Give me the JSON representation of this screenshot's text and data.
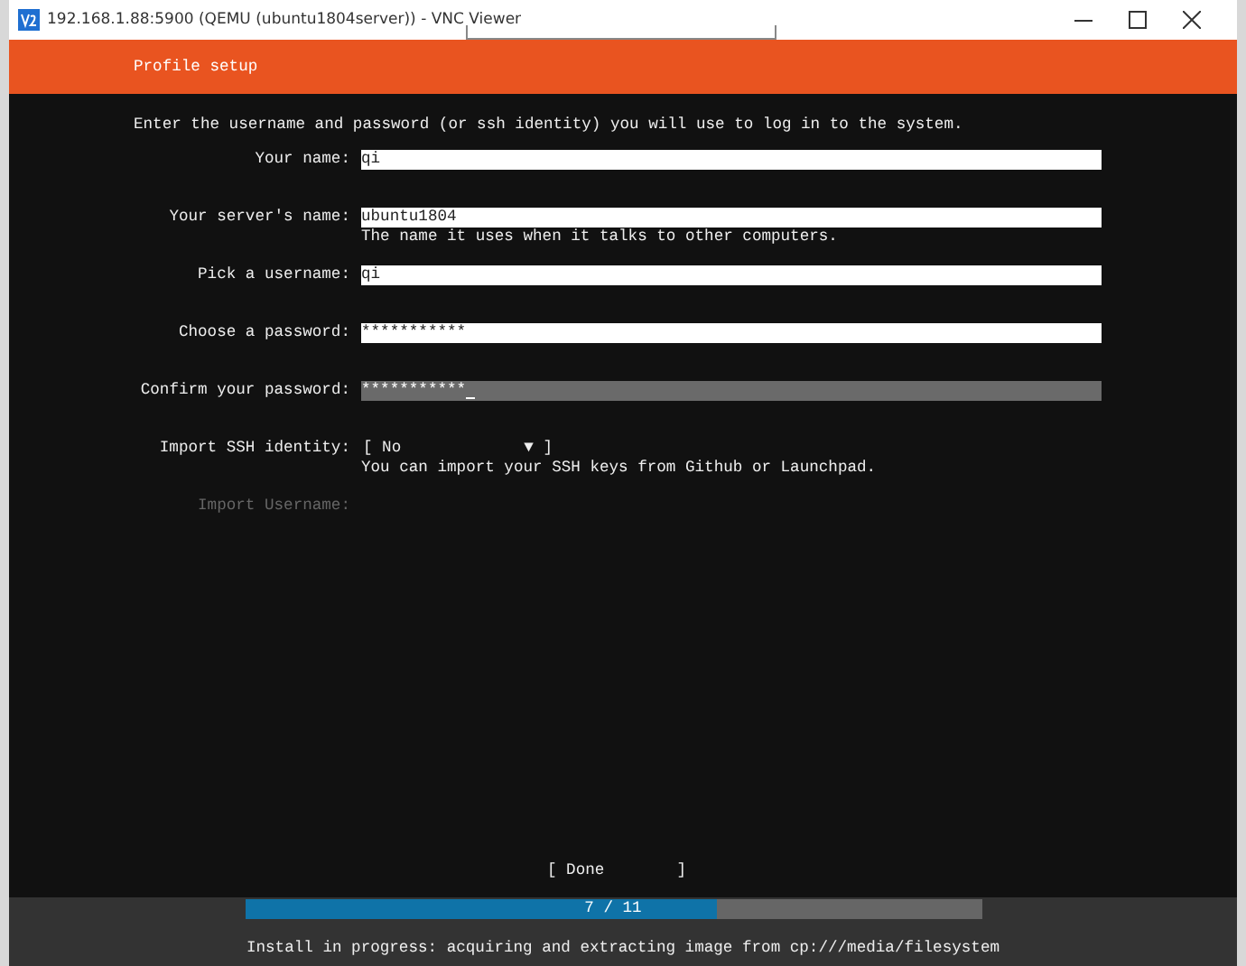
{
  "window": {
    "title": "192.168.1.88:5900 (QEMU (ubuntu1804server)) - VNC Viewer"
  },
  "header": {
    "title": "Profile setup"
  },
  "intro": "Enter the username and password (or ssh identity) you will use to log in to the system.",
  "fields": [
    {
      "kind": "text",
      "label": "Your name:",
      "value": "qi",
      "focused": false
    },
    {
      "kind": "text",
      "label": "Your server's name:",
      "value": "ubuntu1804",
      "help": "The name it uses when it talks to other computers.",
      "focused": false
    },
    {
      "kind": "text",
      "label": "Pick a username:",
      "value": "qi",
      "focused": false
    },
    {
      "kind": "password",
      "label": "Choose a password:",
      "value": "***********",
      "focused": false
    },
    {
      "kind": "password",
      "label": "Confirm your password:",
      "value": "***********",
      "focused": true
    },
    {
      "kind": "dropdown",
      "label": "Import SSH identity:",
      "open": "[",
      "value": "No",
      "arrow": "▼",
      "close": "]",
      "help": "You can import your SSH keys from Github or Launchpad."
    }
  ],
  "import_username": {
    "label": "Import Username:",
    "disabled": true
  },
  "done_button": {
    "open": "[",
    "label": "Done",
    "close": "]"
  },
  "progress": {
    "level": 0.64,
    "label": "7 / 11"
  },
  "status": "Install in progress: acquiring and extracting image from cp:///media/filesystem"
}
